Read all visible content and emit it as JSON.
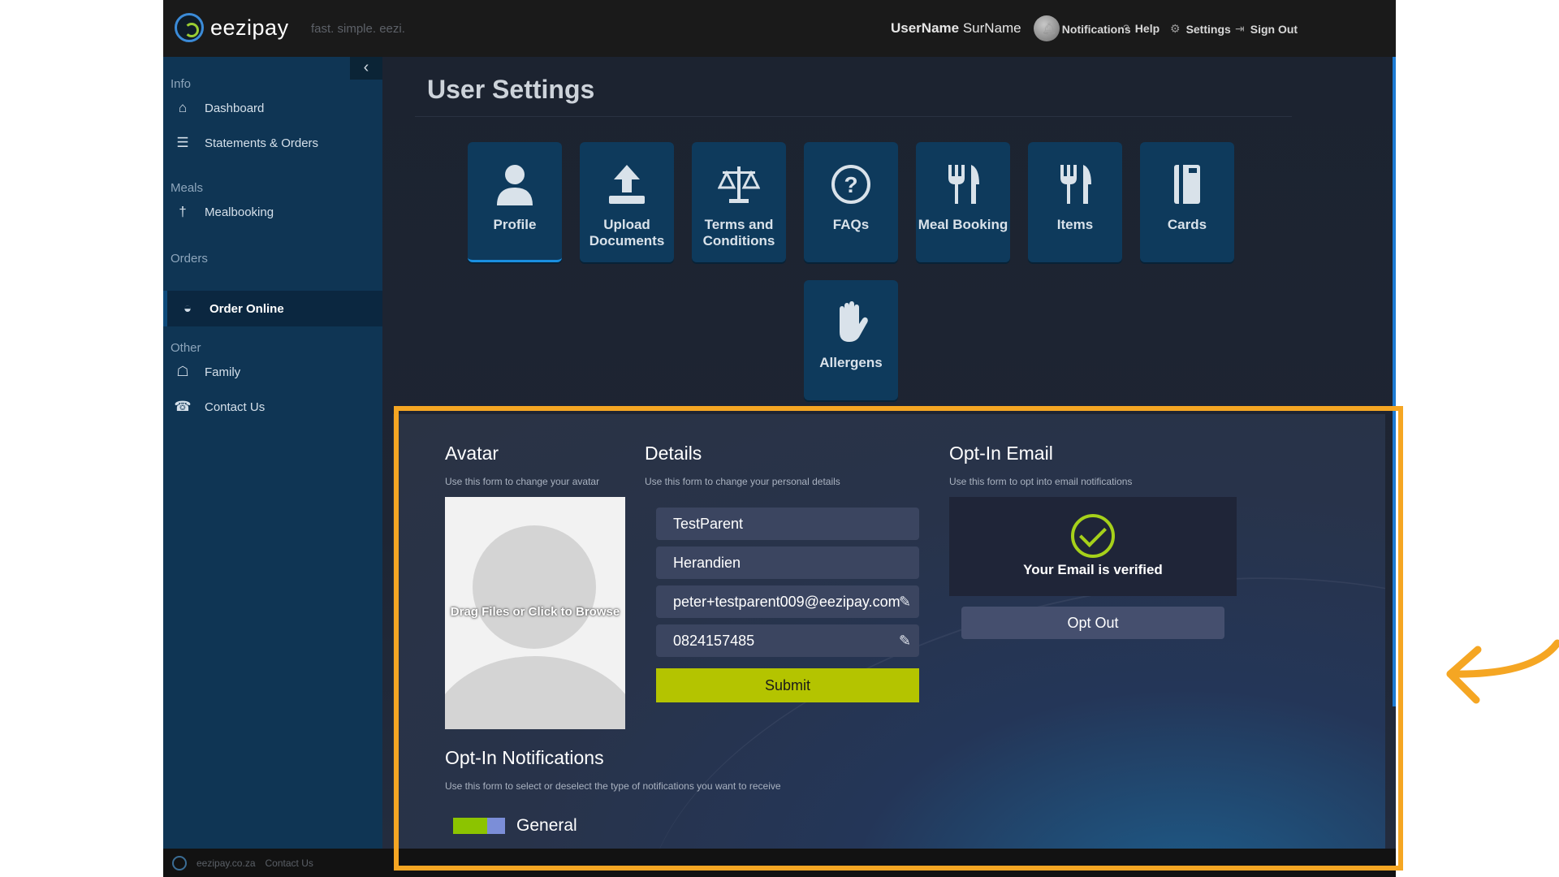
{
  "topbar": {
    "logo_text": "eezipay",
    "tagline": "fast. simple. eezi.",
    "user_first": "UserName",
    "user_last": " SurName",
    "links": [
      {
        "label": "Notifications",
        "icon": "bell-icon",
        "glyph": "⌂"
      },
      {
        "label": "Help",
        "icon": "question-icon",
        "glyph": "?"
      },
      {
        "label": "Settings",
        "icon": "gear-icon",
        "glyph": "⚙"
      },
      {
        "label": "Sign Out",
        "icon": "sign-out-icon",
        "glyph": "⇥"
      }
    ]
  },
  "sidebar": {
    "collapse_glyph": "‹",
    "sections": {
      "info": "Info",
      "meals": "Meals",
      "orders": "Orders",
      "other": "Other"
    },
    "items": {
      "dashboard": {
        "label": "Dashboard",
        "glyph": "⌂"
      },
      "statements": {
        "label": "Statements & Orders",
        "glyph": "☰"
      },
      "mealbooking": {
        "label": "Mealbooking",
        "glyph": "†"
      },
      "order_online": {
        "label": "Order Online",
        "glyph": "◒"
      },
      "family": {
        "label": "Family",
        "glyph": "☖"
      },
      "contact": {
        "label": "Contact Us",
        "glyph": "☎"
      }
    }
  },
  "footer": {
    "domain": "eezipay.co.za",
    "contact": "Contact Us"
  },
  "main": {
    "title": "User Settings",
    "tiles": [
      {
        "label": "Profile",
        "icon": "user-icon"
      },
      {
        "label": "Upload Documents",
        "icon": "upload-icon"
      },
      {
        "label": "Terms and Conditions",
        "icon": "scale-icon"
      },
      {
        "label": "FAQs",
        "icon": "question-circle-icon"
      },
      {
        "label": "Meal Booking",
        "icon": "cutlery-icon"
      },
      {
        "label": "Items",
        "icon": "cutlery-icon"
      },
      {
        "label": "Cards",
        "icon": "card-icon"
      },
      {
        "label": "Allergens",
        "icon": "hand-icon"
      }
    ]
  },
  "avatar": {
    "title": "Avatar",
    "subtitle": "Use this form to change your avatar",
    "drop_text": "Drag Files or Click to Browse"
  },
  "details": {
    "title": "Details",
    "subtitle": "Use this form to change your personal details",
    "first_name": "TestParent",
    "last_name": "Herandien",
    "email": "peter+testparent009@eezipay.com",
    "phone": "0824157485",
    "submit_label": "Submit"
  },
  "optin_email": {
    "title": "Opt-In Email",
    "subtitle": "Use this form to opt into email notifications",
    "status": "Your Email is verified",
    "optout_label": "Opt Out"
  },
  "optin_notifications": {
    "title": "Opt-In Notifications",
    "subtitle": "Use this form to select or deselect the type of notifications you want to receive",
    "general_label": "General",
    "general_enabled": true
  },
  "colors": {
    "accent": "#f5a623",
    "sidebar": "#0f3554",
    "tile": "#0e3a5c",
    "submit": "#b4c400",
    "verified": "#a6d11a"
  }
}
